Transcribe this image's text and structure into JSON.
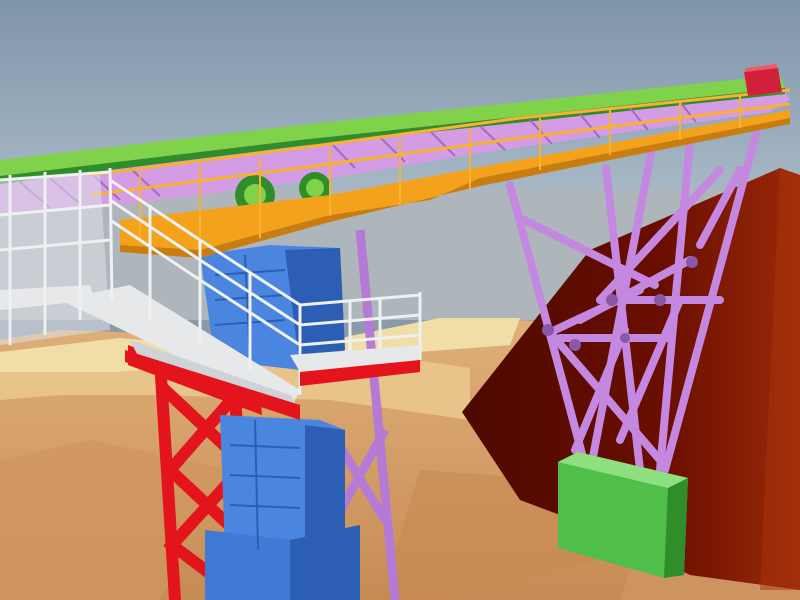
{
  "scene": {
    "colors": {
      "sky_top": "#7f95ab",
      "sky_bottom": "#a9b9c6",
      "haze": "#b9c3cb",
      "ground": "#d29a62",
      "ground_light": "#e8c48a",
      "ground_pale": "#f1dea6",
      "stockpile": "#6a0e00",
      "stockpile_lit": "#9b2a08",
      "truss_purple": "#c488e0",
      "truss_purple_dark": "#8a58a8",
      "walkway_orange": "#f4a21c",
      "belt_green": "#7fd24a",
      "belt_green_dark": "#2f8d2a",
      "tower_red": "#e4141c",
      "hopper_blue": "#4a86e0",
      "hopper_blue_dark": "#2c5fb4",
      "stair_white": "#e6e8ea",
      "footing_green": "#4fbf4a",
      "head_red": "#d0203a"
    }
  }
}
